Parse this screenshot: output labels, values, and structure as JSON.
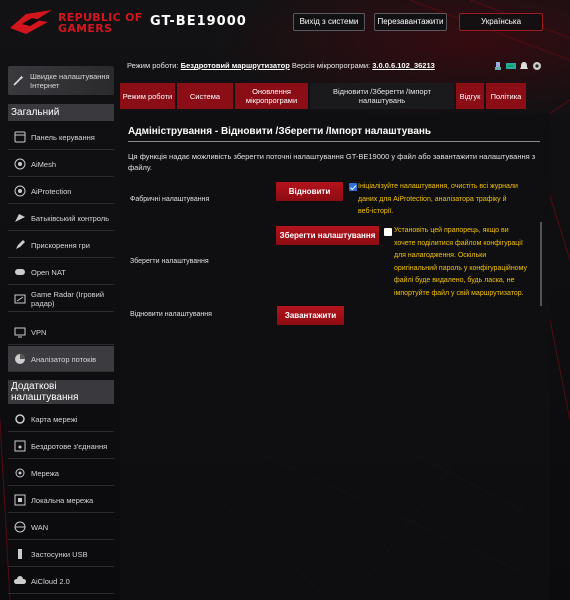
{
  "header": {
    "brand_line1": "REPUBLIC OF",
    "brand_line2": "GAMERS",
    "model": "GT-BE19000",
    "logout_label": "Вихід з системи",
    "reboot_label": "Перезавантажити",
    "language": "Українська"
  },
  "status": {
    "mode_label": "Режим роботи:",
    "mode_value": "Бездротовий маршрутизатор",
    "fw_label": "Версія мікропрограми:",
    "fw_value": "3.0.0.6.102_36213",
    "icons": [
      "usb-icon",
      "network-status-icon",
      "notification-icon",
      "settings-icon"
    ]
  },
  "sidebar": {
    "quick_setup": "Швидке налаштування Інтернет",
    "general_title": "Загальний",
    "general_items": [
      {
        "label": "Панель керування",
        "icon": "dashboard-icon"
      },
      {
        "label": "AiMesh",
        "icon": "aimesh-icon"
      },
      {
        "label": "AiProtection",
        "icon": "shield-icon"
      },
      {
        "label": "Батьківський контроль",
        "icon": "parental-icon"
      },
      {
        "label": "Прискорення гри",
        "icon": "rocket-icon"
      },
      {
        "label": "Open NAT",
        "icon": "gamepad-icon"
      },
      {
        "label": "Game Radar (Ігровий радар)",
        "icon": "radar-icon"
      },
      {
        "label": "VPN",
        "icon": "vpn-icon"
      },
      {
        "label": "Аналізатор потоків",
        "icon": "traffic-icon"
      }
    ],
    "advanced_title": "Додаткові налаштування",
    "advanced_items": [
      {
        "label": "Карта мережі",
        "icon": "network-map-icon"
      },
      {
        "label": "Бездротове з'єднання",
        "icon": "wireless-icon"
      },
      {
        "label": "Мережа",
        "icon": "lan-icon"
      },
      {
        "label": "Локальна мережа",
        "icon": "local-network-icon"
      },
      {
        "label": "WAN",
        "icon": "globe-icon"
      },
      {
        "label": "Застосунки USB",
        "icon": "usb-icon"
      },
      {
        "label": "AiCloud 2.0",
        "icon": "cloud-icon"
      }
    ]
  },
  "tabs": [
    {
      "label": "Режим роботи"
    },
    {
      "label": "Система"
    },
    {
      "label": "Оновлення мікропрограми"
    },
    {
      "label": "Відновити /Зберегти /Імпорт налаштувань",
      "active": true
    },
    {
      "label": "Відгук"
    },
    {
      "label": "Політика"
    }
  ],
  "main": {
    "title": "Адміністрування - Відновити /Зберегти /Імпорт налаштувань",
    "description": "Ця функція надає можливість зберегти поточні налаштування GT-BE19000 у файл або завантажити налаштування з файлу.",
    "rows": {
      "factory": {
        "label": "Фабричні налаштування",
        "button": "Відновити",
        "checked": true,
        "note": "Ініціалізуйте налаштування, очистіть всі журнали даних для AiProtection, аналізатора трафіку й веб-історії."
      },
      "save": {
        "label": "Зберегти налаштування",
        "button": "Зберегти налаштування",
        "checked": false,
        "note": "Установіть цей прапорець, якщо ви хочете поділитися файлом конфігурації для налагодження. Оскільки оригінальний пароль у конфігураційному файлі буде видалено, будь ласка, не імпортуйте файл у свій маршрутизатор."
      },
      "restore": {
        "label": "Відновити налаштування",
        "button": "Завантажити"
      }
    }
  },
  "colors": {
    "accent": "#8b0e17",
    "button": "#b5131c",
    "note": "#f2c200",
    "checkbox": "#2f6fdc"
  }
}
